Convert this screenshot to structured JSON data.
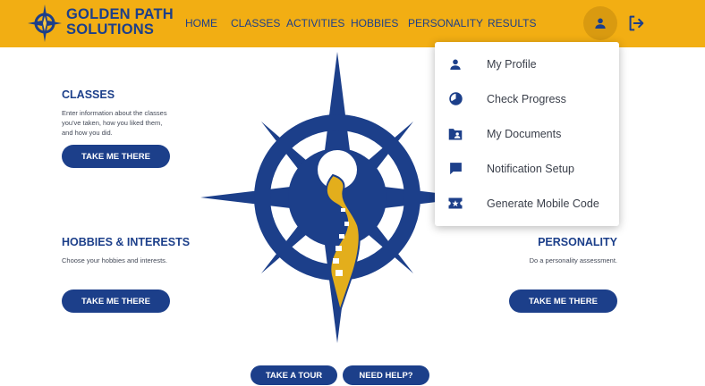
{
  "brand": {
    "line1": "GOLDEN PATH",
    "line2": "SOLUTIONS"
  },
  "nav": {
    "home": "HOME",
    "classes": "CLASSES",
    "activities": "ACTIVITIES",
    "hobbies": "HOBBIES",
    "personality": "PERSONALITY",
    "results": "RESULTS"
  },
  "header_icons": {
    "user": "person-icon",
    "logout": "logout-icon"
  },
  "classes": {
    "title": "CLASSES",
    "desc_lines": [
      "Enter information about the classes",
      "you've taken, how you liked them,",
      "and how you did."
    ],
    "button": "TAKE ME THERE"
  },
  "hobbies": {
    "title": "HOBBIES & INTERESTS",
    "desc_lines": [
      "Choose your hobbies and interests."
    ],
    "button": "TAKE ME THERE"
  },
  "personality": {
    "title": "PERSONALITY",
    "desc_lines": [
      "Do a personality assessment."
    ],
    "button": "TAKE ME THERE"
  },
  "footer": {
    "tour": "TAKE A TOUR",
    "help": "NEED HELP?"
  },
  "dropdown": {
    "items": [
      {
        "label": "My Profile",
        "icon": "person-icon"
      },
      {
        "label": "Check Progress",
        "icon": "progress-icon"
      },
      {
        "label": "My Documents",
        "icon": "folder-account-icon"
      },
      {
        "label": "Notification Setup",
        "icon": "chat-icon"
      },
      {
        "label": "Generate Mobile Code",
        "icon": "ticket-star-icon"
      }
    ]
  },
  "colors": {
    "accent": "#f2ae13",
    "brand_blue": "#1c3f8a",
    "hero_gold": "#e3ae1c"
  }
}
